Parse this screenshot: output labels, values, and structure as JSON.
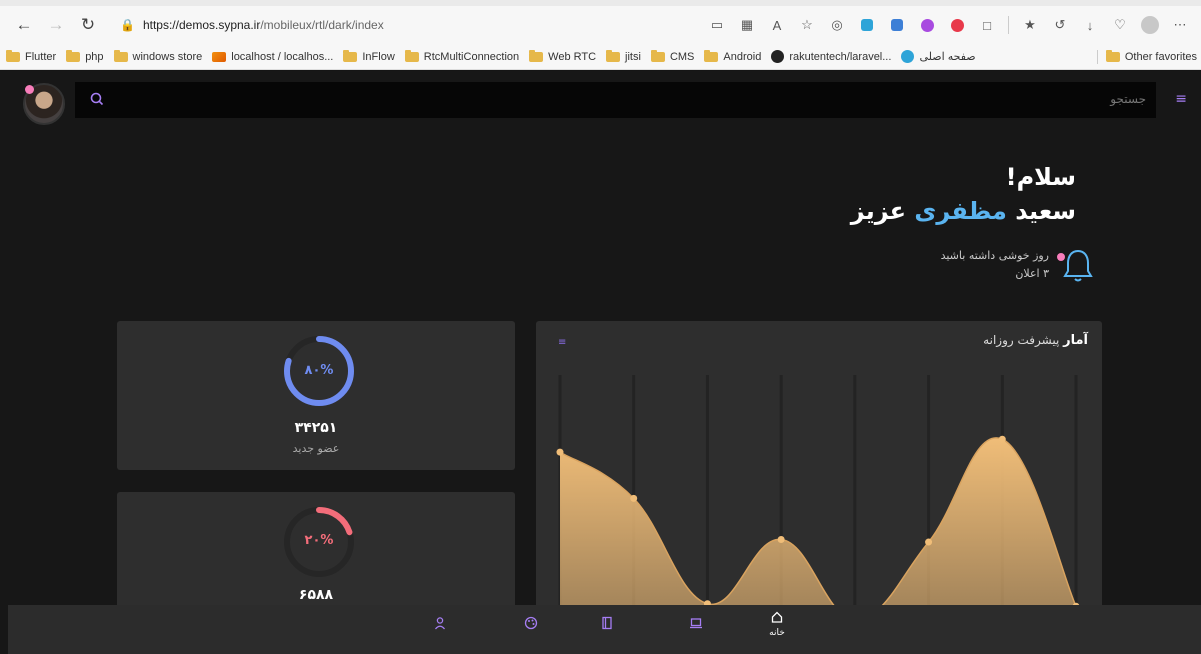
{
  "browser": {
    "url_host": "https://demos.sypna.ir",
    "url_path": "/mobileux/rtl/dark/index",
    "bookmarks": [
      "Flutter",
      "php",
      "windows store",
      "localhost / localhos...",
      "InFlow",
      "RtcMultiConnection",
      "Web RTC",
      "jitsi",
      "CMS",
      "Android",
      "rakutentech/laravel...",
      "صفحه اصلی"
    ],
    "other_favorites": "Other favorites"
  },
  "header": {
    "search_placeholder": "جستجو"
  },
  "greeting": {
    "title": "سلام!",
    "name_first": "سعید",
    "name_highlight": "مظفری",
    "name_last": "عزیز"
  },
  "notification": {
    "message": "روز خوشی داشته باشید",
    "count_text": "۳ اعلان"
  },
  "stats": [
    {
      "percent_label": "۸۰%",
      "percent": 80,
      "value": "۳۴۲۵۱",
      "caption": "عضو جدید",
      "color": "#6f8cf0"
    },
    {
      "percent_label": "۲۰%",
      "percent": 20,
      "value": "۶۵۸۸",
      "caption": "",
      "color": "#f36d7a"
    }
  ],
  "chart_card": {
    "title_bold": "آمار",
    "title_rest": "پیشرفت روزانه"
  },
  "chart_data": {
    "type": "area",
    "x": [
      1,
      2,
      3,
      4,
      5,
      6,
      7,
      8
    ],
    "values": [
      70,
      52,
      11,
      36,
      5,
      35,
      75,
      10
    ],
    "ylim": [
      0,
      100
    ],
    "grid": true,
    "fill_color": "#f0bd78"
  },
  "bottom_nav": {
    "home_label": "خانه",
    "items": [
      "user-icon",
      "palette-icon",
      "book-icon",
      "laptop-icon",
      "home-icon"
    ]
  }
}
